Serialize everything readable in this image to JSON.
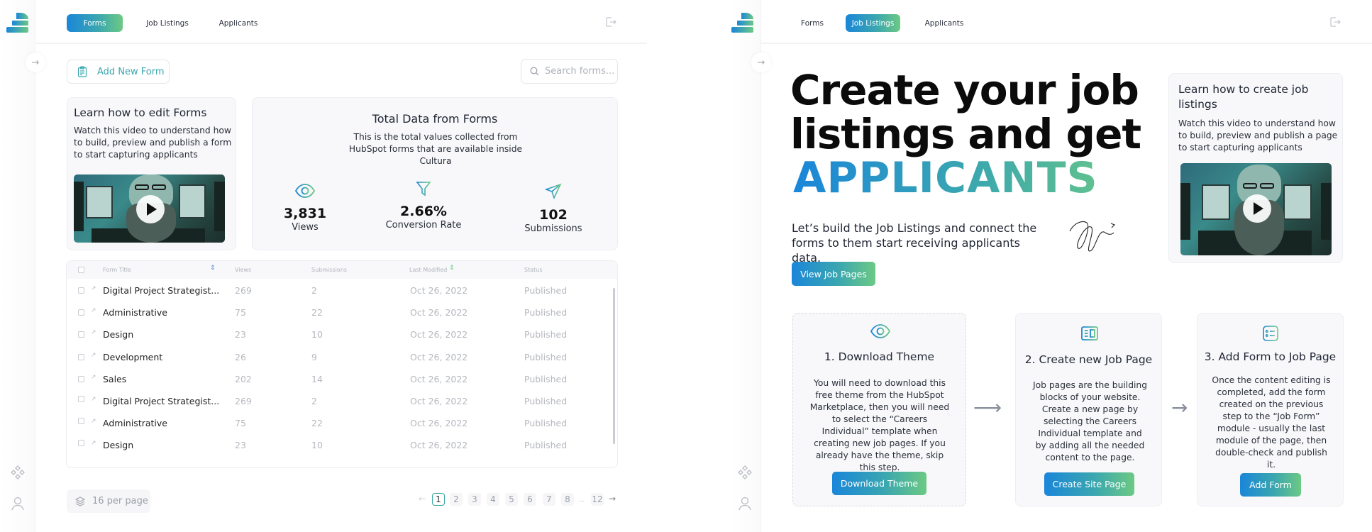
{
  "brand": {
    "accent_start": "#1a86d9",
    "accent_end": "#6cc984"
  },
  "left": {
    "nav": {
      "tabs": [
        {
          "label": "Forms",
          "active": true
        },
        {
          "label": "Job Listings",
          "active": false
        },
        {
          "label": "Applicants",
          "active": false
        }
      ]
    },
    "add_form_label": "Add New Form",
    "search_placeholder": "Search forms...",
    "learn": {
      "title": "Learn how to edit Forms",
      "text": "Watch this video to understand how to build, preview and publish a form to start capturing applicants"
    },
    "totals": {
      "title": "Total Data from Forms",
      "subtitle": "This is the total values collected from HubSpot forms that are available inside Cultura",
      "stats": [
        {
          "icon": "eye-icon",
          "value": "3,831",
          "label": "Views"
        },
        {
          "icon": "funnel-icon",
          "value": "2.66%",
          "label": "Conversion Rate"
        },
        {
          "icon": "send-icon",
          "value": "102",
          "label": "Submissions"
        }
      ]
    },
    "table": {
      "columns": [
        "Form Title",
        "Views",
        "Submissions",
        "Last Modified",
        "Status"
      ],
      "rows": [
        {
          "title": "Digital Project Strategist...",
          "views": "269",
          "submissions": "2",
          "modified": "Oct 26, 2022",
          "status": "Published"
        },
        {
          "title": "Administrative",
          "views": "75",
          "submissions": "22",
          "modified": "Oct 26, 2022",
          "status": "Published"
        },
        {
          "title": "Design",
          "views": "23",
          "submissions": "10",
          "modified": "Oct 26, 2022",
          "status": "Published"
        },
        {
          "title": "Development",
          "views": "26",
          "submissions": "9",
          "modified": "Oct 26, 2022",
          "status": "Published"
        },
        {
          "title": "Sales",
          "views": "202",
          "submissions": "14",
          "modified": "Oct 26, 2022",
          "status": "Published"
        },
        {
          "title": "Digital Project Strategist...",
          "views": "269",
          "submissions": "2",
          "modified": "Oct 26, 2022",
          "status": "Published"
        },
        {
          "title": "Administrative",
          "views": "75",
          "submissions": "22",
          "modified": "Oct 26, 2022",
          "status": "Published"
        },
        {
          "title": "Design",
          "views": "23",
          "submissions": "10",
          "modified": "Oct 26, 2022",
          "status": "Published"
        }
      ]
    },
    "per_page_label": "16 per page",
    "pagination": {
      "pages": [
        "1",
        "2",
        "3",
        "4",
        "5",
        "6",
        "7",
        "8",
        "...",
        "12"
      ],
      "current": "1",
      "prev": "←",
      "next": "→"
    }
  },
  "right": {
    "nav": {
      "tabs": [
        {
          "label": "Forms",
          "active": false
        },
        {
          "label": "Job Listings",
          "active": true
        },
        {
          "label": "Applicants",
          "active": false
        }
      ]
    },
    "hero": {
      "line1": "Create your job",
      "line2": "listings and get",
      "highlight": "APPLICANTS"
    },
    "intro": "Let’s build the Job Listings and connect the forms to them start receiving applicants data.",
    "view_button": "View Job Pages",
    "learn": {
      "title": "Learn how to create job listings",
      "text": "Watch this video to understand how to build, preview and publish a page to start capturing applicants"
    },
    "steps": [
      {
        "icon": "eye-icon",
        "title": "1. Download Theme",
        "text": "You will need to download this free theme from the HubSpot Marketplace, then you will need to select the “Careers Individual” template when creating new job pages. If you already have the theme, skip this step.",
        "button": "Download Theme"
      },
      {
        "icon": "page-layout-icon",
        "title": "2. Create new Job Page",
        "text": "Job pages are the building blocks of your website. Create a new page by selecting the Careers Individual template and by adding all the needed content to the page.",
        "button": "Create Site Page"
      },
      {
        "icon": "form-list-icon",
        "title": "3. Add Form to Job Page",
        "text": "Once the content editing is completed, add the form created on the previous step to the “Job Form” module - usually the last module of the page, then double-check and publish it.",
        "button": "Add Form"
      }
    ]
  }
}
